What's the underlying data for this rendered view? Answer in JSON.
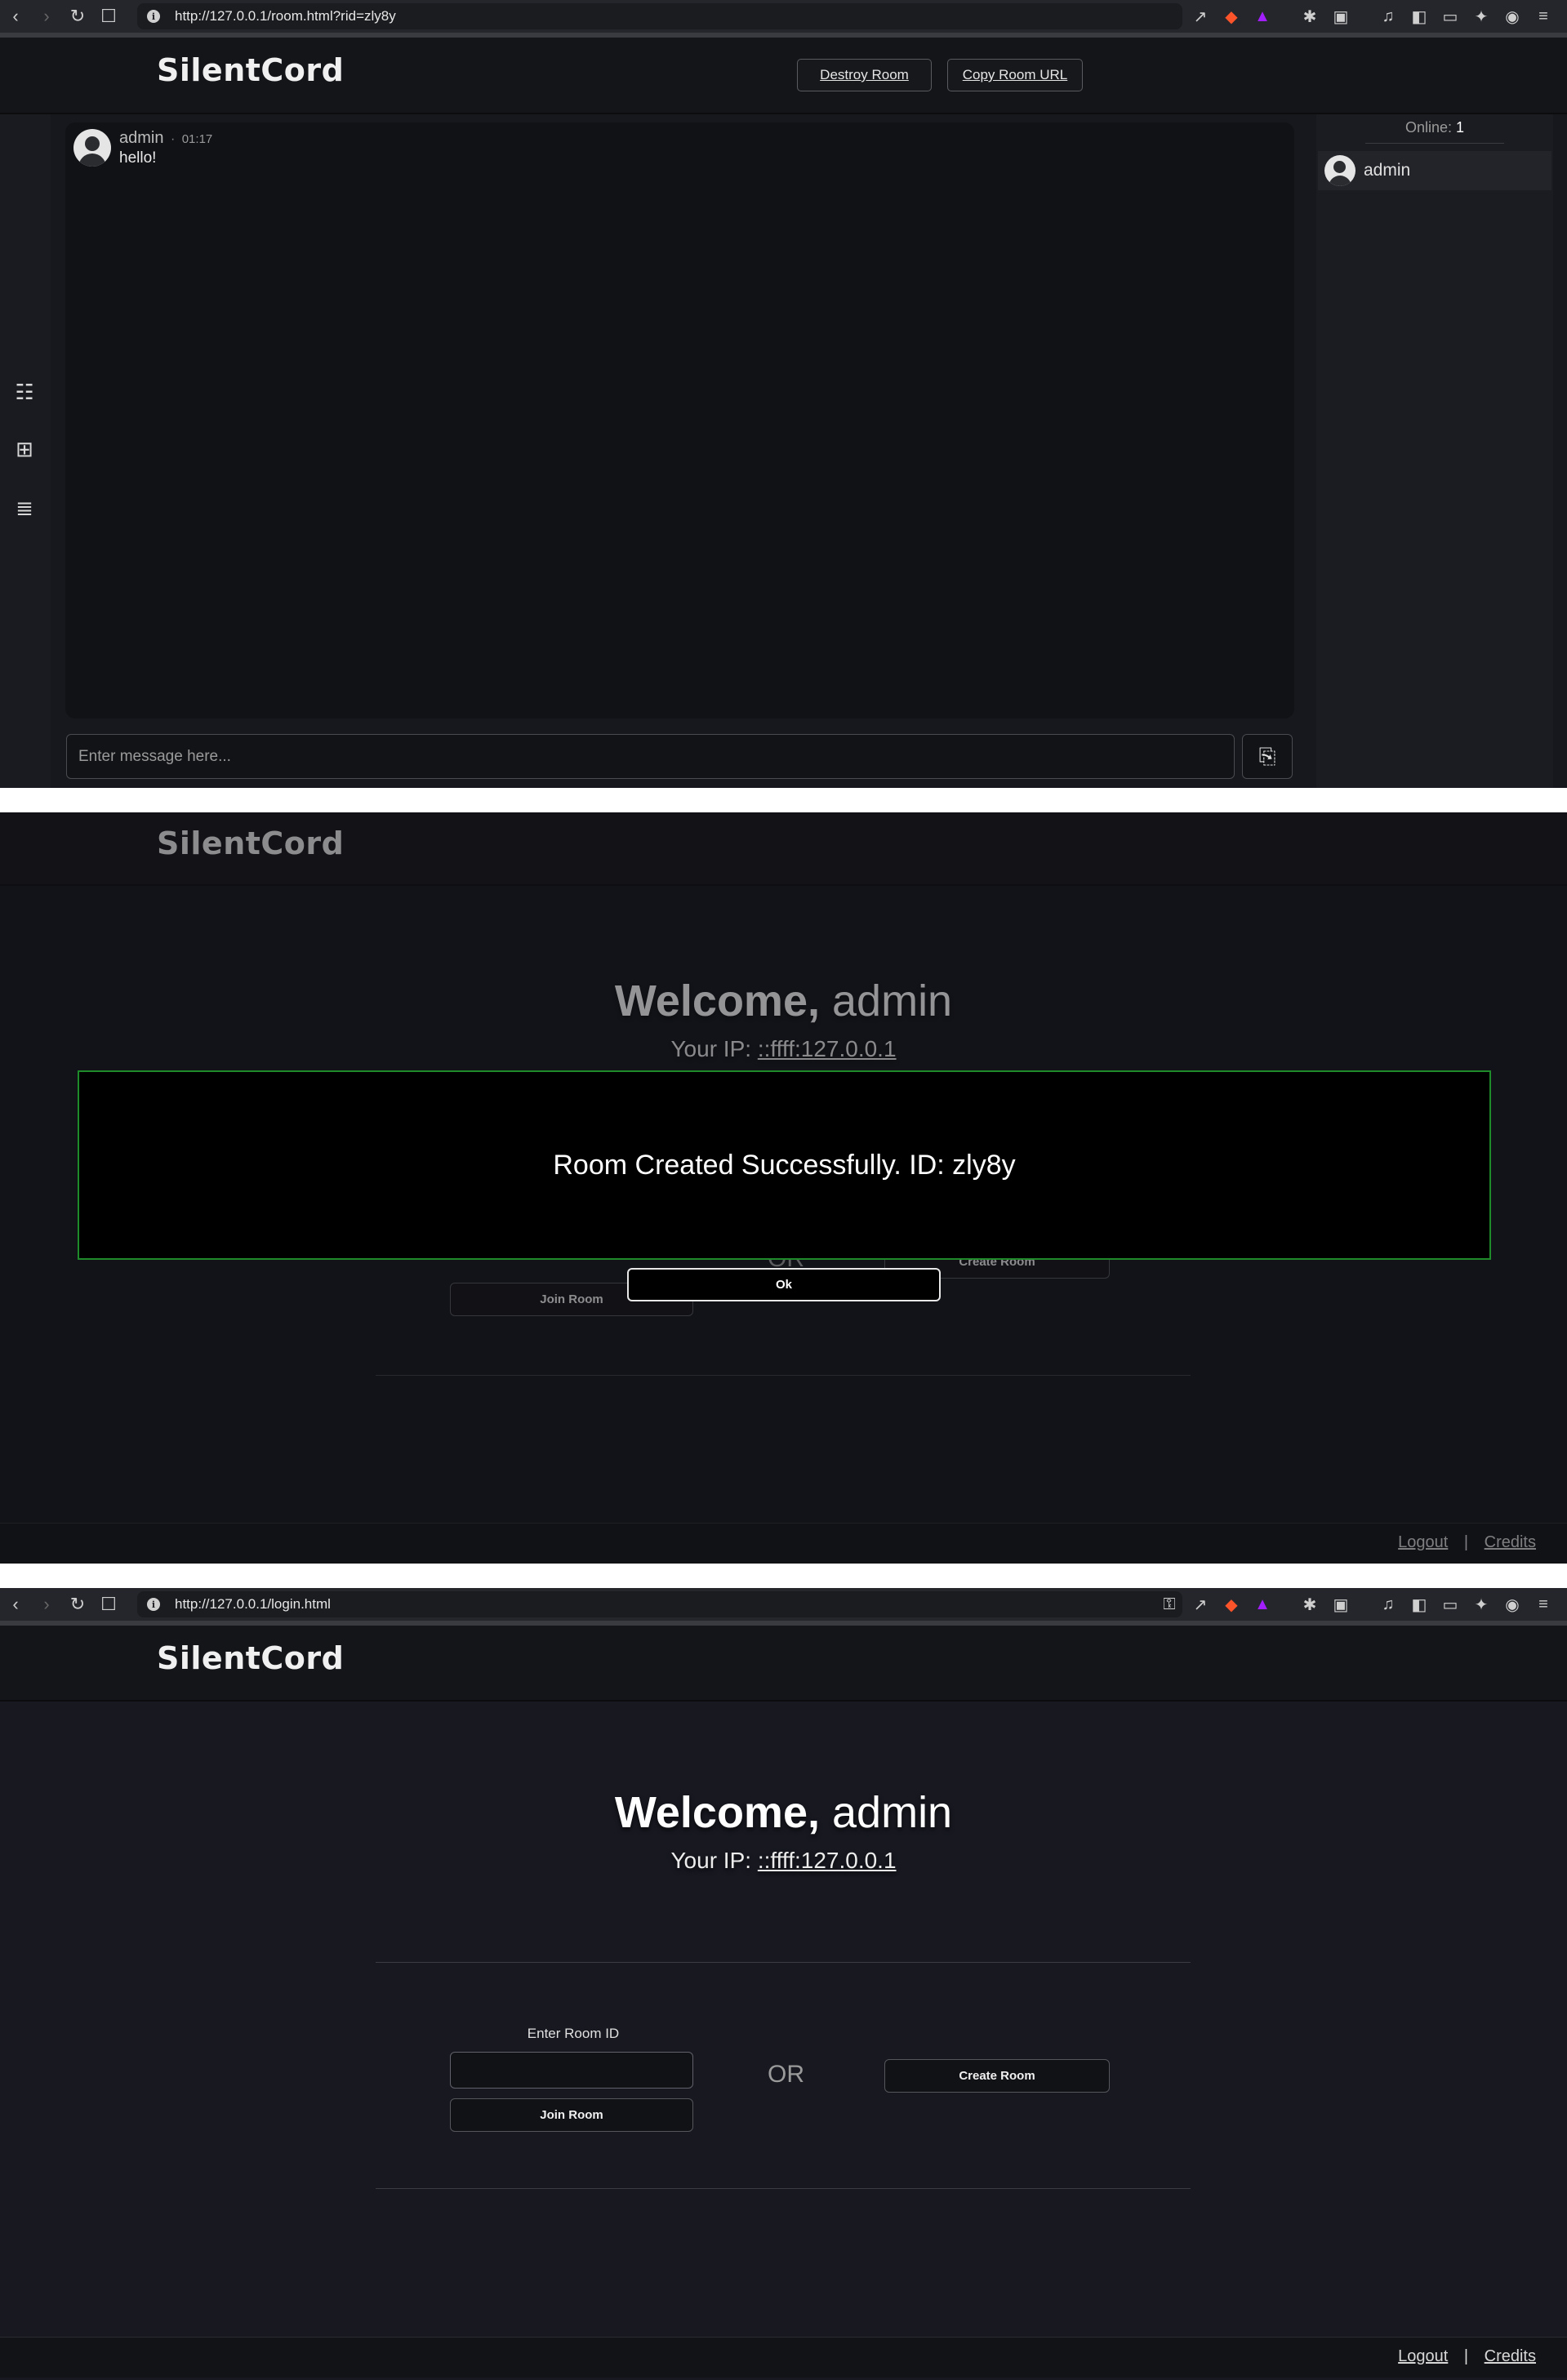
{
  "browser_top": {
    "url": "http://127.0.0.1/room.html?rid=zly8y"
  },
  "browser_bottom": {
    "url": "http://127.0.0.1/login.html"
  },
  "app": {
    "name": "SilentCord"
  },
  "room": {
    "destroy_label": "Destroy Room",
    "copy_url_label": "Copy Room URL",
    "message": {
      "author": "admin",
      "separator": "·",
      "time": "01:17",
      "text": "hello!"
    },
    "input_placeholder": "Enter message here...",
    "online_label": "Online:",
    "online_count": "1",
    "users": [
      "admin"
    ]
  },
  "welcome": {
    "greeting": "Welcome,",
    "username": "admin",
    "ip_label": "Your IP:",
    "ip_value": "::ffff:127.0.0.1",
    "room_id_label": "Enter Room ID",
    "join_label": "Join Room",
    "or_label": "OR",
    "create_label": "Create Room"
  },
  "modal": {
    "message": "Room Created Successfully. ID: zly8y",
    "ok_label": "Ok",
    "border_color": "#1f8a2a"
  },
  "footer": {
    "logout_label": "Logout",
    "separator": "|",
    "credits_label": "Credits"
  },
  "icons": {
    "back": "back-icon",
    "forward": "forward-icon",
    "reload": "reload-icon",
    "bookmark": "bookmark-icon",
    "chat": "chat-icon",
    "add_chat": "add-chat-icon",
    "playlist": "playlist-icon",
    "attach": "attach-icon"
  }
}
